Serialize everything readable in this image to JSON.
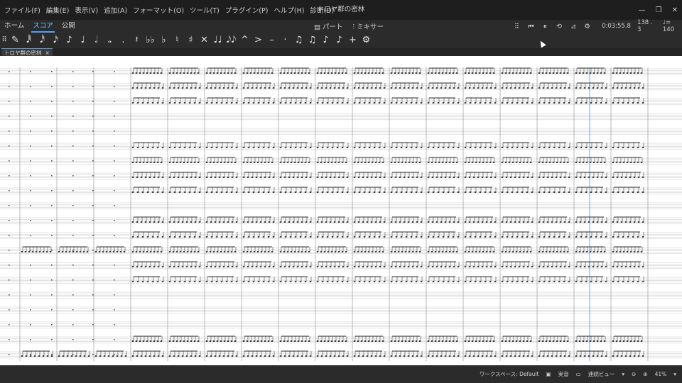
{
  "window": {
    "title": "トロヤ群の密林"
  },
  "menu": [
    "ファイル(F)",
    "編集(E)",
    "表示(V)",
    "追加(A)",
    "フォーマット(O)",
    "ツール(T)",
    "プラグイン(P)",
    "ヘルプ(H)",
    "診断(D)"
  ],
  "tabs": [
    "ホーム",
    "スコア",
    "公開"
  ],
  "center_tools": {
    "parts": "パート",
    "mixer": "ミキサー"
  },
  "playback": {
    "time": "0:03:55.8",
    "position": "138 . 3",
    "tempo": "♩= 140"
  },
  "note_input_palette": [
    "✎",
    "𝅘𝅥𝅱",
    "𝅘𝅥𝅰",
    "𝅘𝅥𝅯",
    "♪",
    "♩",
    "𝅗𝅥",
    "𝅝",
    ".",
    "𝄽",
    "♭♭",
    "♭",
    "♮",
    "♯",
    "✕",
    "♩♩",
    "𝅘𝅥𝅮𝅘𝅥𝅮",
    "^",
    ">",
    "–",
    "·",
    "♫",
    "♫",
    "♪",
    "♪",
    "+",
    "⚙"
  ],
  "score_tab": {
    "label": "トロヤ群の密林",
    "close": "×"
  },
  "status": {
    "workspace": "ワークスペース: Default",
    "concert": "実音",
    "view_mode": "連続ビュー",
    "zoom": "41%"
  }
}
